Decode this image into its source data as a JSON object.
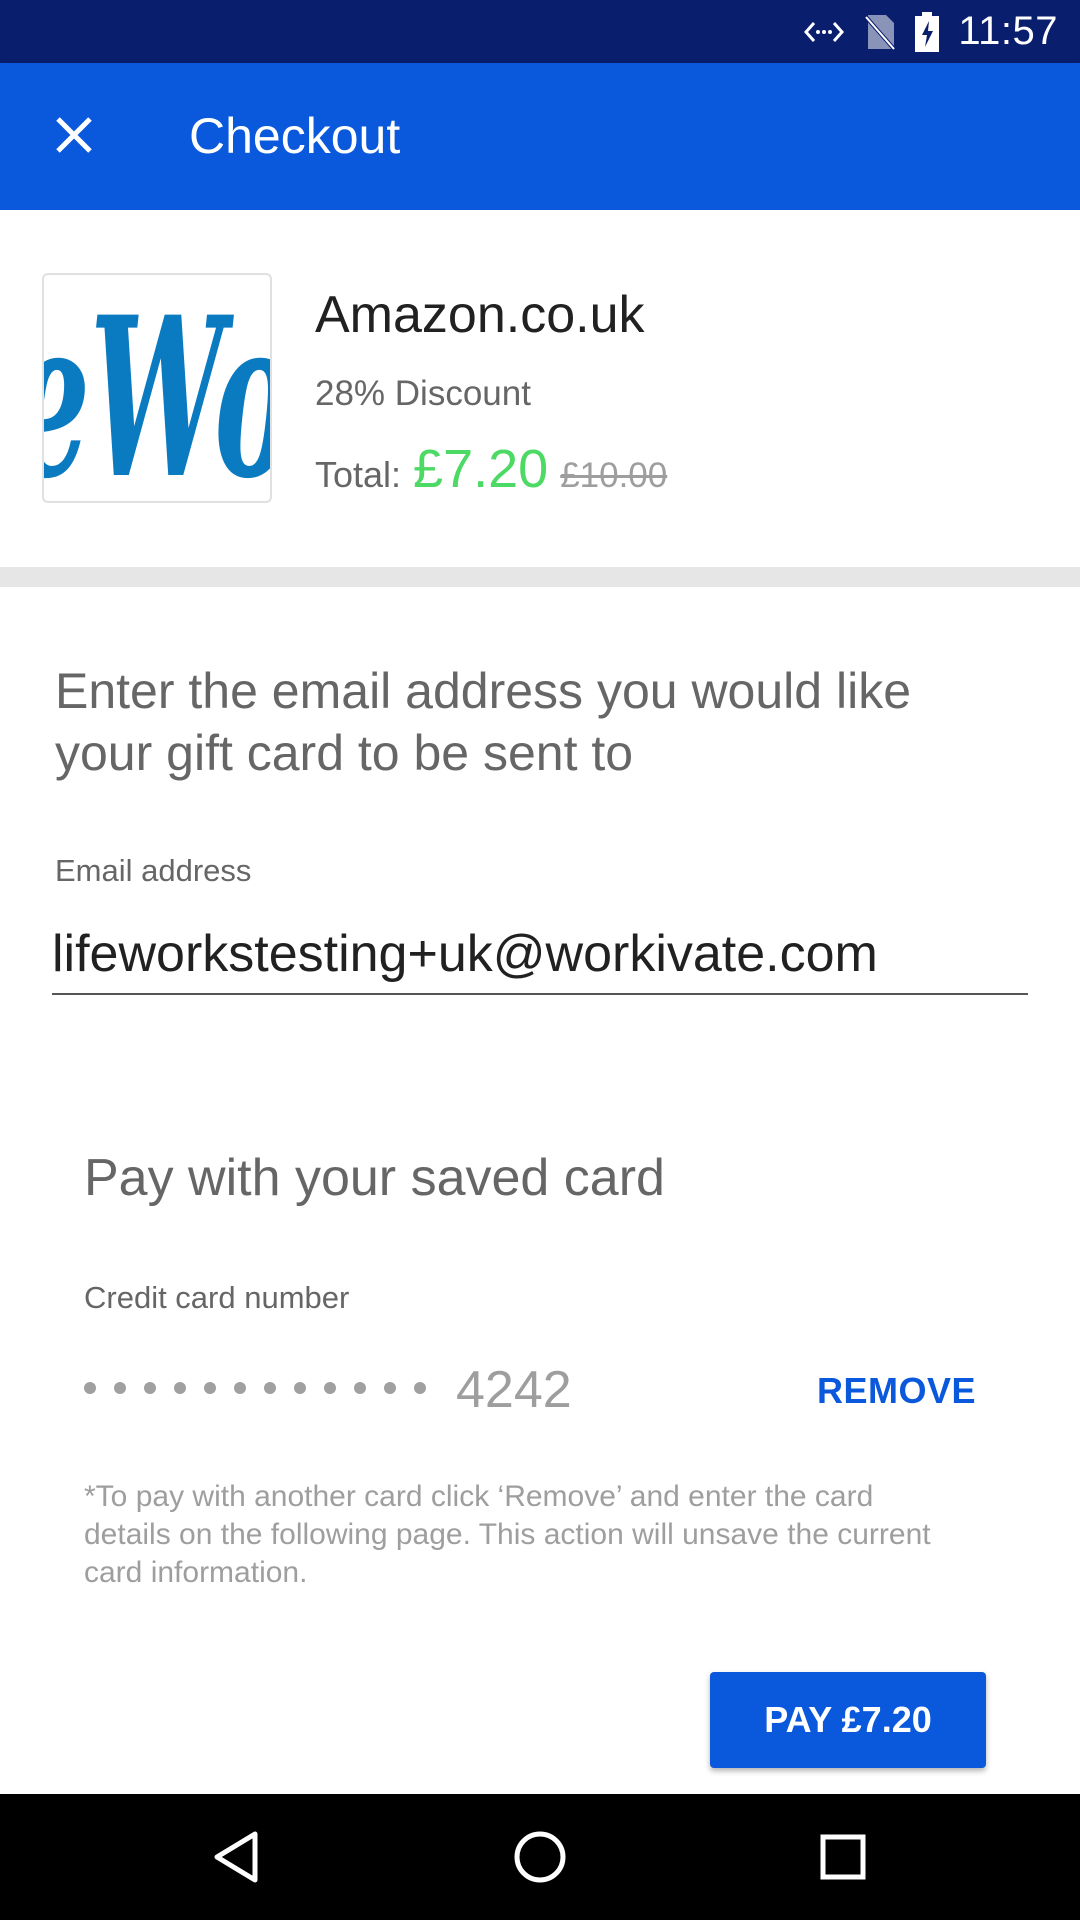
{
  "status_bar": {
    "time": "11:57",
    "icons": [
      "data-transfer-icon",
      "no-sim-icon",
      "battery-charging-icon"
    ]
  },
  "app_bar": {
    "title": "Checkout",
    "close_icon": "close-icon",
    "background": "#0a58dc"
  },
  "product": {
    "logo_text": "eWo",
    "name": "Amazon.co.uk",
    "discount": "28% Discount",
    "total_label": "Total:",
    "price": "£7.20",
    "original_price": "£10.00",
    "price_color": "#4cd964"
  },
  "email_section": {
    "prompt": "Enter the email address you would like your gift card to be sent to",
    "label": "Email address",
    "value": "lifeworkstesting+uk@workivate.com"
  },
  "saved_card": {
    "title": "Pay with your saved card",
    "label": "Credit card number",
    "masked_dot_count": 12,
    "last4": "4242",
    "remove_label": "REMOVE",
    "note": "*To pay with another card click ‘Remove’ and enter the card details on the following page. This action will unsave the current card information."
  },
  "pay_button": {
    "label": "PAY £7.20"
  },
  "nav_bar": {
    "icons": [
      "back-icon",
      "home-icon",
      "recents-icon"
    ]
  }
}
